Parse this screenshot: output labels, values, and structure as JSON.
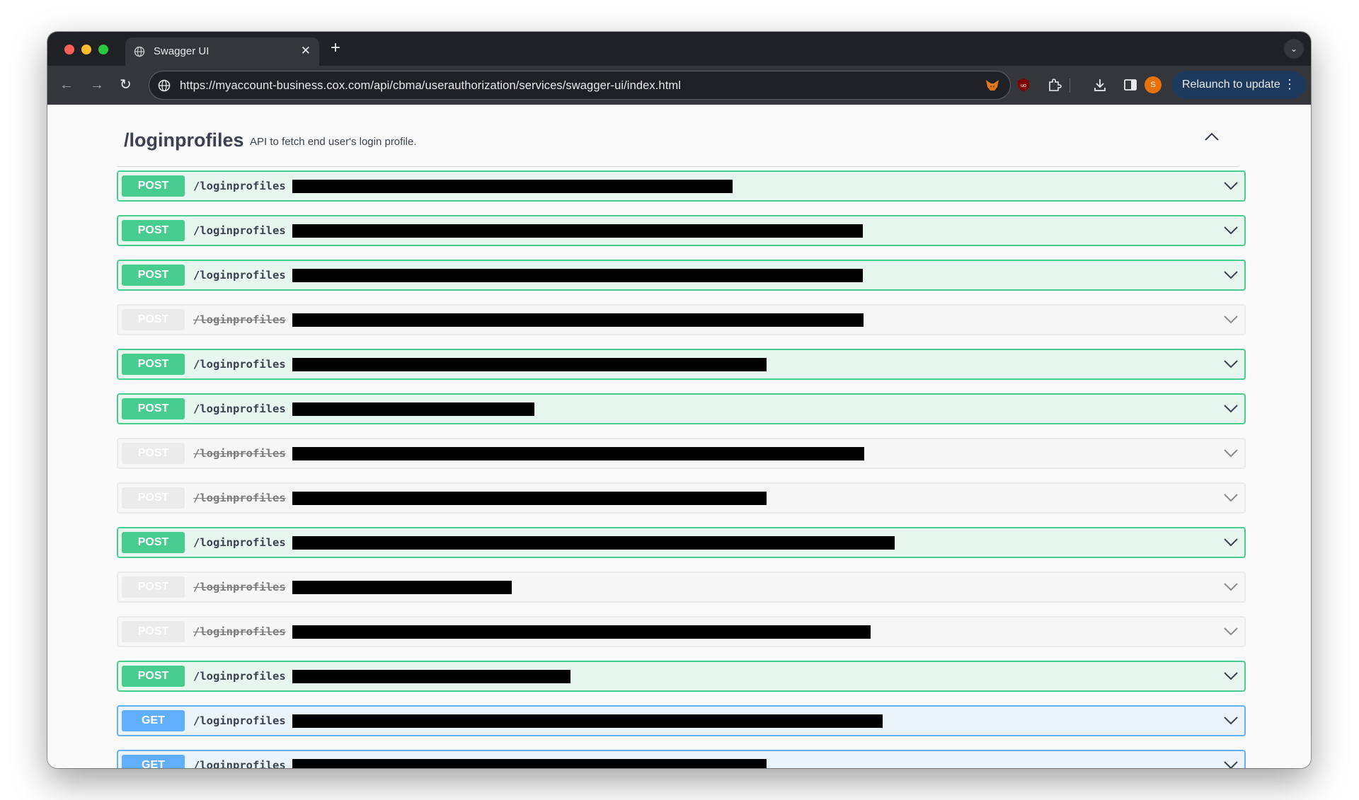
{
  "browser": {
    "tab": {
      "title": "Swagger UI",
      "close_glyph": "✕"
    },
    "new_tab_glyph": "+",
    "tab_search_glyph": "⌄",
    "address": {
      "url": "https://myaccount-business.cox.com/api/cbma/userauthorization/services/swagger-ui/index.html"
    },
    "avatar_initial": "S",
    "relaunch_label": "Relaunch to update",
    "relaunch_menu_glyph": "⋮",
    "toolbar_icons": [
      "metamask-fox-icon",
      "ublock-icon",
      "extensions-puzzle-icon",
      "download-icon",
      "side-panel-icon",
      "profile-avatar"
    ]
  },
  "section": {
    "title": "/loginprofiles",
    "description": "API to fetch end user's login profile.",
    "expanded": true
  },
  "operations": [
    {
      "method": "POST",
      "path": "/loginprofiles",
      "deprecated": false,
      "redacted": true
    },
    {
      "method": "POST",
      "path": "/loginprofiles",
      "deprecated": false,
      "redacted": true
    },
    {
      "method": "POST",
      "path": "/loginprofiles",
      "deprecated": false,
      "redacted": true
    },
    {
      "method": "POST",
      "path": "/loginprofiles",
      "deprecated": true,
      "redacted": true
    },
    {
      "method": "POST",
      "path": "/loginprofiles",
      "deprecated": false,
      "redacted": true
    },
    {
      "method": "POST",
      "path": "/loginprofiles",
      "deprecated": false,
      "redacted": true
    },
    {
      "method": "POST",
      "path": "/loginprofiles",
      "deprecated": true,
      "redacted": true
    },
    {
      "method": "POST",
      "path": "/loginprofiles",
      "deprecated": true,
      "redacted": true
    },
    {
      "method": "POST",
      "path": "/loginprofiles",
      "deprecated": false,
      "redacted": true
    },
    {
      "method": "POST",
      "path": "/loginprofiles",
      "deprecated": true,
      "redacted": true
    },
    {
      "method": "POST",
      "path": "/loginprofiles",
      "deprecated": true,
      "redacted": true
    },
    {
      "method": "POST",
      "path": "/loginprofiles",
      "deprecated": false,
      "redacted": true
    },
    {
      "method": "GET",
      "path": "/loginprofiles",
      "deprecated": false,
      "redacted": true
    },
    {
      "method": "GET",
      "path": "/loginprofiles",
      "deprecated": false,
      "redacted": true
    }
  ],
  "colors": {
    "post": "#49cc90",
    "get": "#61affe",
    "deprecated": "#ebebeb",
    "text": "#3b4151",
    "chrome_dark": "#202124",
    "relaunch_bg": "#1d3a5c"
  }
}
